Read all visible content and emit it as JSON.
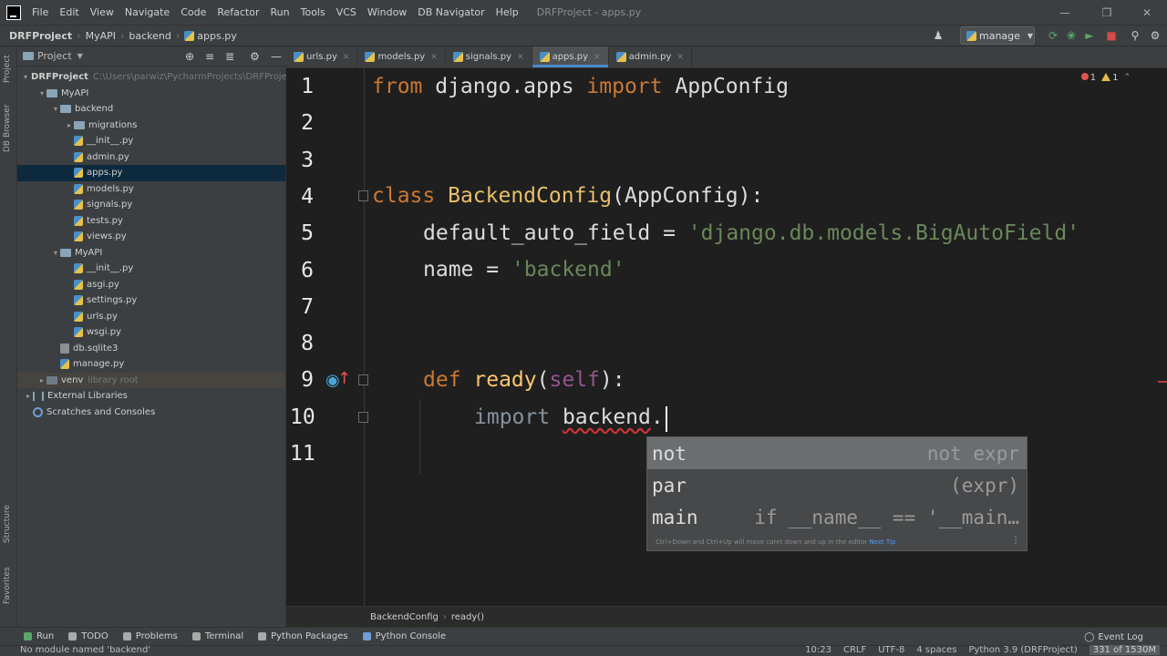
{
  "menu": {
    "items": [
      "File",
      "Edit",
      "View",
      "Navigate",
      "Code",
      "Refactor",
      "Run",
      "Tools",
      "VCS",
      "Window",
      "DB Navigator",
      "Help"
    ],
    "window_title": "DRFProject - apps.py"
  },
  "navbar": {
    "crumbs": [
      "DRFProject",
      "MyAPI",
      "backend",
      "apps.py"
    ],
    "run_config": "manage"
  },
  "stripe": {
    "project": "Project",
    "db_browser": "DB Browser",
    "structure": "Structure",
    "favorites": "Favorites"
  },
  "project_panel": {
    "header": "Project",
    "tree": [
      {
        "label": "DRFProject",
        "hint": "C:\\Users\\parwiz\\PycharmProjects\\DRFProject",
        "depth": 0,
        "kind": "folder",
        "expanded": true
      },
      {
        "label": "MyAPI",
        "depth": 1,
        "kind": "folder",
        "expanded": true
      },
      {
        "label": "backend",
        "depth": 2,
        "kind": "folder",
        "expanded": true
      },
      {
        "label": "migrations",
        "depth": 3,
        "kind": "folder",
        "expanded": false
      },
      {
        "label": "__init__.py",
        "depth": 3,
        "kind": "py"
      },
      {
        "label": "admin.py",
        "depth": 3,
        "kind": "py"
      },
      {
        "label": "apps.py",
        "depth": 3,
        "kind": "py",
        "selected": true
      },
      {
        "label": "models.py",
        "depth": 3,
        "kind": "py"
      },
      {
        "label": "signals.py",
        "depth": 3,
        "kind": "py"
      },
      {
        "label": "tests.py",
        "depth": 3,
        "kind": "py"
      },
      {
        "label": "views.py",
        "depth": 3,
        "kind": "py"
      },
      {
        "label": "MyAPI",
        "depth": 2,
        "kind": "folder",
        "expanded": true
      },
      {
        "label": "__init__.py",
        "depth": 3,
        "kind": "py"
      },
      {
        "label": "asgi.py",
        "depth": 3,
        "kind": "py"
      },
      {
        "label": "settings.py",
        "depth": 3,
        "kind": "py"
      },
      {
        "label": "urls.py",
        "depth": 3,
        "kind": "py"
      },
      {
        "label": "wsgi.py",
        "depth": 3,
        "kind": "py"
      },
      {
        "label": "db.sqlite3",
        "depth": 2,
        "kind": "db"
      },
      {
        "label": "manage.py",
        "depth": 2,
        "kind": "py"
      },
      {
        "label": "venv",
        "hint": "library root",
        "depth": 1,
        "kind": "folder",
        "expanded": false,
        "libroot": true
      },
      {
        "label": "External Libraries",
        "depth": 0,
        "kind": "lib",
        "expanded": false
      },
      {
        "label": "Scratches and Consoles",
        "depth": 0,
        "kind": "scratch"
      }
    ]
  },
  "tabs": [
    {
      "label": "urls.py",
      "active": false
    },
    {
      "label": "models.py",
      "active": false
    },
    {
      "label": "signals.py",
      "active": false
    },
    {
      "label": "apps.py",
      "active": true
    },
    {
      "label": "admin.py",
      "active": false
    }
  ],
  "editor": {
    "line_numbers": [
      "1",
      "2",
      "3",
      "4",
      "5",
      "6",
      "7",
      "8",
      "9",
      "10",
      "11"
    ],
    "line1": {
      "kw_from": "from",
      "module": " django.apps ",
      "kw_import": "import",
      "name": " AppConfig"
    },
    "line4": {
      "kw_class": "class",
      "cls": " BackendConfig",
      "rest": "(AppConfig):"
    },
    "line5": {
      "name": "default_auto_field = ",
      "str": "'django.db.models.BigAutoField'"
    },
    "line6": {
      "name": "name = ",
      "str": "'backend'"
    },
    "line9": {
      "kw_def": "def",
      "fn": " ready",
      "p1": "(",
      "self": "self",
      "p2": "):"
    },
    "line10": {
      "kw_import": "import ",
      "module": "backend",
      "dot": "."
    },
    "errors": {
      "error_count": "1",
      "warning_count": "1"
    }
  },
  "completion": {
    "items": [
      {
        "label": "not",
        "hint": "not expr",
        "selected": true
      },
      {
        "label": "par",
        "hint": "(expr)",
        "selected": false
      },
      {
        "label": "main",
        "hint": "if __name__ == '__main…",
        "selected": false
      }
    ],
    "tip": "Ctrl+Down and Ctrl+Up will move caret down and up in the editor",
    "tip_link": "Next Tip"
  },
  "editor_crumbs": [
    "BackendConfig",
    "ready()"
  ],
  "tool_windows": [
    {
      "label": "Run",
      "color": "#59a869"
    },
    {
      "label": "TODO",
      "color": "#aaaaaa"
    },
    {
      "label": "Problems",
      "color": "#aaaaaa"
    },
    {
      "label": "Terminal",
      "color": "#aaaaaa"
    },
    {
      "label": "Python Packages",
      "color": "#aaaaaa"
    },
    {
      "label": "Python Console",
      "color": "#6da0d6"
    }
  ],
  "event_log": "Event Log",
  "status": {
    "message": "No module named 'backend'",
    "position": "10:23",
    "line_sep": "CRLF",
    "encoding": "UTF-8",
    "indent": "4 spaces",
    "interpreter": "Python 3.9 (DRFProject)",
    "memory": "331 of 1530M"
  },
  "colors": {
    "accent": "#4a88c7",
    "error": "#e05555",
    "warning": "#e6b94a",
    "keyword": "#cc7832",
    "string": "#6a8759"
  }
}
